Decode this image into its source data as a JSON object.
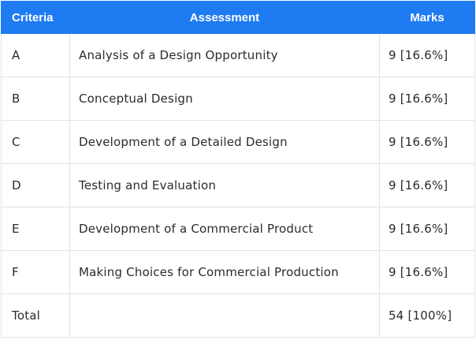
{
  "table": {
    "headers": {
      "criteria": "Criteria",
      "assessment": "Assessment",
      "marks": "Marks"
    },
    "rows": [
      {
        "criteria": "A",
        "assessment": "Analysis of a Design Opportunity",
        "marks": "9 [16.6%]"
      },
      {
        "criteria": "B",
        "assessment": "Conceptual Design",
        "marks": "9 [16.6%]"
      },
      {
        "criteria": "C",
        "assessment": "Development of a Detailed Design",
        "marks": "9 [16.6%]"
      },
      {
        "criteria": "D",
        "assessment": "Testing and Evaluation",
        "marks": "9 [16.6%]"
      },
      {
        "criteria": "E",
        "assessment": "Development of a Commercial Product",
        "marks": "9 [16.6%]"
      },
      {
        "criteria": "F",
        "assessment": "Making Choices for Commercial Production",
        "marks": "9 [16.6%]"
      },
      {
        "criteria": "Total",
        "assessment": "",
        "marks": "54 [100%]"
      }
    ]
  },
  "colors": {
    "header_background": "#1E7BF2",
    "header_text": "#FFFFFF",
    "border": "#E3E3E3"
  }
}
